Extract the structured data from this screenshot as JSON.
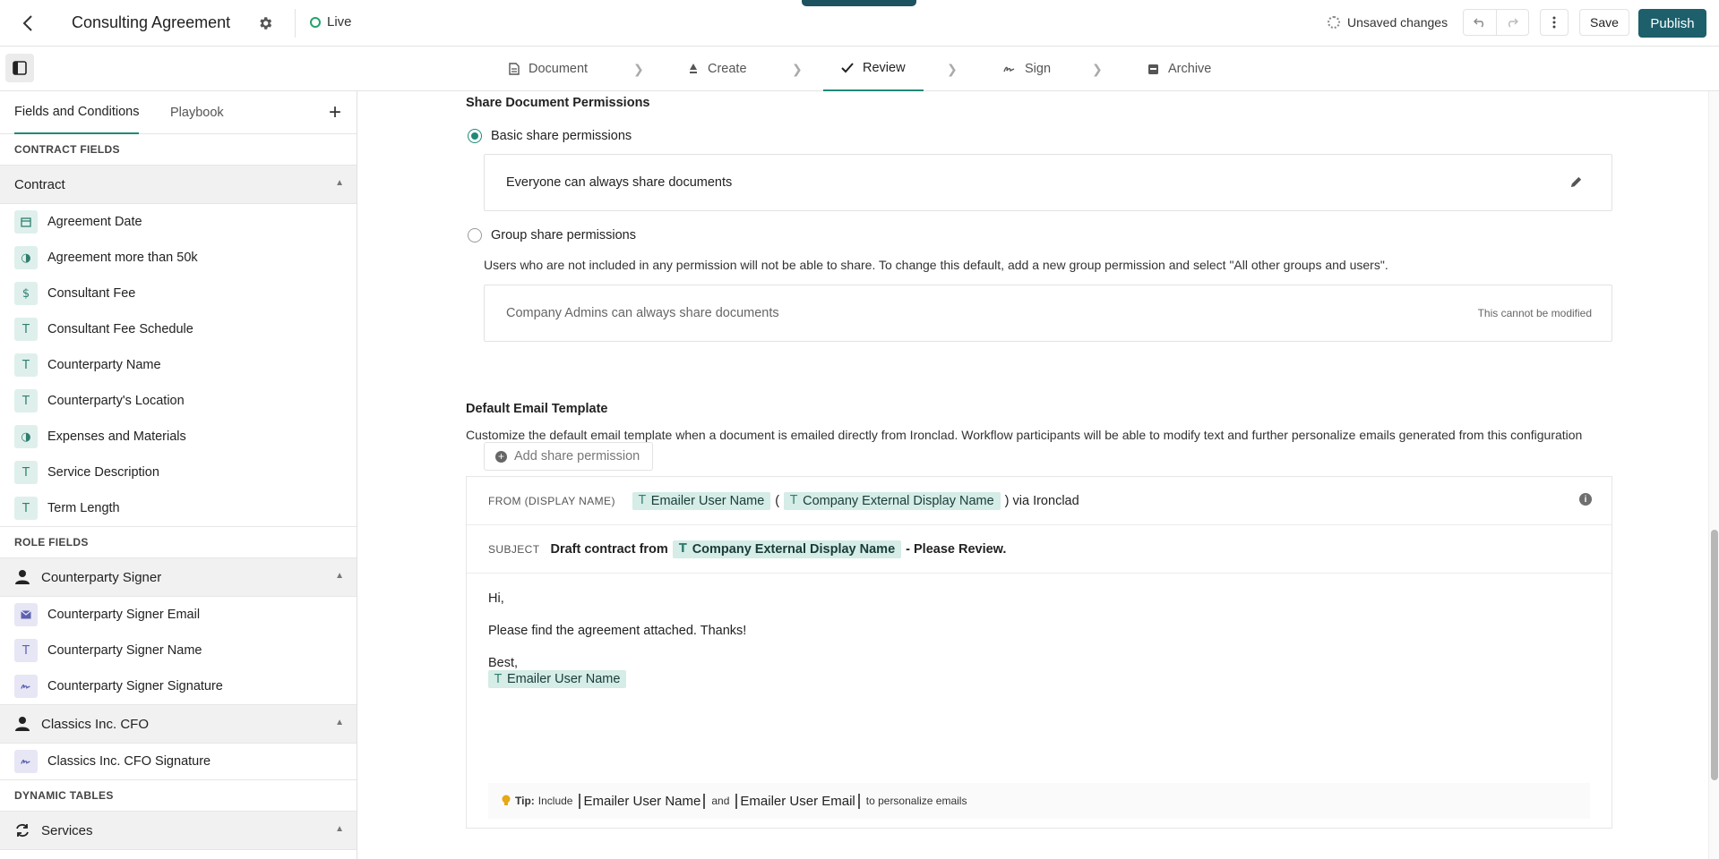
{
  "header": {
    "title": "Consulting Agreement",
    "status": "Live",
    "unsaved": "Unsaved changes",
    "save_label": "Save",
    "publish_label": "Publish"
  },
  "steps": [
    {
      "label": "Document",
      "icon": "document-icon"
    },
    {
      "label": "Create",
      "icon": "create-icon"
    },
    {
      "label": "Review",
      "icon": "check-icon",
      "active": true
    },
    {
      "label": "Sign",
      "icon": "signature-icon"
    },
    {
      "label": "Archive",
      "icon": "archive-icon"
    }
  ],
  "sidebar": {
    "tabs": [
      "Fields and Conditions",
      "Playbook"
    ],
    "contract_fields_label": "CONTRACT FIELDS",
    "contract_group": "Contract",
    "contract_fields": [
      {
        "label": "Agreement Date",
        "icon": "calendar-icon"
      },
      {
        "label": "Agreement more than 50k",
        "icon": "condition-icon"
      },
      {
        "label": "Consultant Fee",
        "icon": "dollar-icon"
      },
      {
        "label": "Consultant Fee Schedule",
        "icon": "text-icon"
      },
      {
        "label": "Counterparty Name",
        "icon": "text-icon"
      },
      {
        "label": "Counterparty's Location",
        "icon": "text-icon"
      },
      {
        "label": "Expenses and Materials",
        "icon": "condition-icon"
      },
      {
        "label": "Service Description",
        "icon": "text-icon"
      },
      {
        "label": "Term Length",
        "icon": "text-icon"
      }
    ],
    "role_fields_label": "ROLE FIELDS",
    "role_groups": [
      {
        "name": "Counterparty Signer",
        "fields": [
          {
            "label": "Counterparty Signer Email",
            "icon": "email-icon"
          },
          {
            "label": "Counterparty Signer Name",
            "icon": "text-icon"
          },
          {
            "label": "Counterparty Signer Signature",
            "icon": "signature-icon"
          }
        ]
      },
      {
        "name": "Classics Inc. CFO",
        "fields": [
          {
            "label": "Classics Inc. CFO Signature",
            "icon": "signature-icon"
          }
        ]
      }
    ],
    "dynamic_tables_label": "DYNAMIC TABLES",
    "dynamic_group": "Services"
  },
  "share": {
    "heading": "Share Document Permissions",
    "basic_label": "Basic share permissions",
    "basic_selected": true,
    "basic_rule": "Everyone can always share documents",
    "group_label": "Group share permissions",
    "group_note": "Users who are not included in any permission will not be able to share. To change this default, add a new group permission and select \"All other groups and users\".",
    "admin_rule": "Company Admins can always share documents",
    "admin_note": "This cannot be modified",
    "add_label": "Add share permission"
  },
  "email": {
    "heading": "Default Email Template",
    "description": "Customize the default email template when a document is emailed directly from Ironclad. Workflow participants will be able to modify text and further personalize emails generated from this configuration",
    "from_label": "FROM (DISPLAY NAME)",
    "from_chip_1": "Emailer User Name",
    "from_chip_2": "Company External Display Name",
    "paren_open": "(",
    "from_suffix": ") via Ironclad",
    "subject_label": "SUBJECT",
    "subject_prefix": "Draft contract from",
    "subject_chip": "Company External Display Name",
    "subject_suffix": "- Please Review.",
    "greeting": "Hi,",
    "line1": "Please find the agreement attached. Thanks!",
    "signoff": "Best,",
    "signature_chip": "Emailer User Name",
    "tip_label": "Tip:",
    "tip_include": "Include",
    "tip_tag_1": "Emailer User Name",
    "tip_and": "and",
    "tip_tag_2": "Emailer User Email",
    "tip_suffix": "to personalize emails"
  },
  "colors": {
    "accent": "#1f8a77",
    "publish": "#1d5f6b",
    "chip": "#d5ece7"
  }
}
